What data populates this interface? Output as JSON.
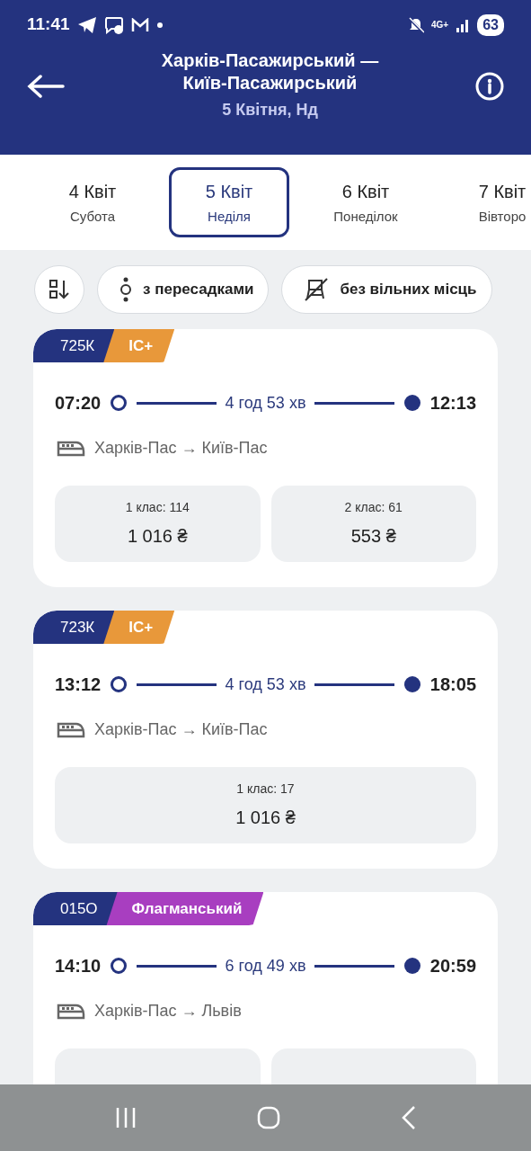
{
  "status_bar": {
    "time": "11:41",
    "network": "4G+",
    "battery": "63"
  },
  "header": {
    "title_line1": "Харків-Пасажирський —",
    "title_line2": "Київ-Пасажирський",
    "date": "5 Квітня, Нд"
  },
  "dates": [
    {
      "day": "4 Квіт",
      "weekday": "Субота",
      "selected": false
    },
    {
      "day": "5 Квіт",
      "weekday": "Неділя",
      "selected": true
    },
    {
      "day": "6 Квіт",
      "weekday": "Понеділок",
      "selected": false
    },
    {
      "day": "7 Квіт",
      "weekday": "Вівторо",
      "selected": false
    }
  ],
  "filters": [
    {
      "kind": "sort"
    },
    {
      "kind": "transfers",
      "label": "з пересадками"
    },
    {
      "kind": "no-seats",
      "label": "без вільних місць"
    }
  ],
  "trains": [
    {
      "number": "725К",
      "type": "IC+",
      "color": "#e8983a",
      "departure": "07:20",
      "duration": "4 год 53 хв",
      "arrival": "12:13",
      "route": "Харків-Пас → Київ-Пас",
      "fares": [
        {
          "kind": "fare",
          "class": "1 клас: 114",
          "price": "1 016 ₴"
        },
        {
          "kind": "fare",
          "class": "2 клас: 61",
          "price": "553 ₴"
        }
      ]
    },
    {
      "number": "723К",
      "type": "IC+",
      "color": "#e8983a",
      "departure": "13:12",
      "duration": "4 год 53 хв",
      "arrival": "18:05",
      "route": "Харків-Пас → Київ-Пас",
      "fares": [
        {
          "kind": "fare",
          "class": "1 клас: 17",
          "price": "1 016 ₴"
        }
      ]
    },
    {
      "number": "015О",
      "type": "Флагманський",
      "color": "#a83ec0",
      "departure": "14:10",
      "duration": "6 год 49 хв",
      "arrival": "20:59",
      "route": "Харків-Пас → Львів",
      "fares": [
        {
          "kind": "hidden"
        },
        {
          "kind": "hidden"
        }
      ]
    }
  ]
}
